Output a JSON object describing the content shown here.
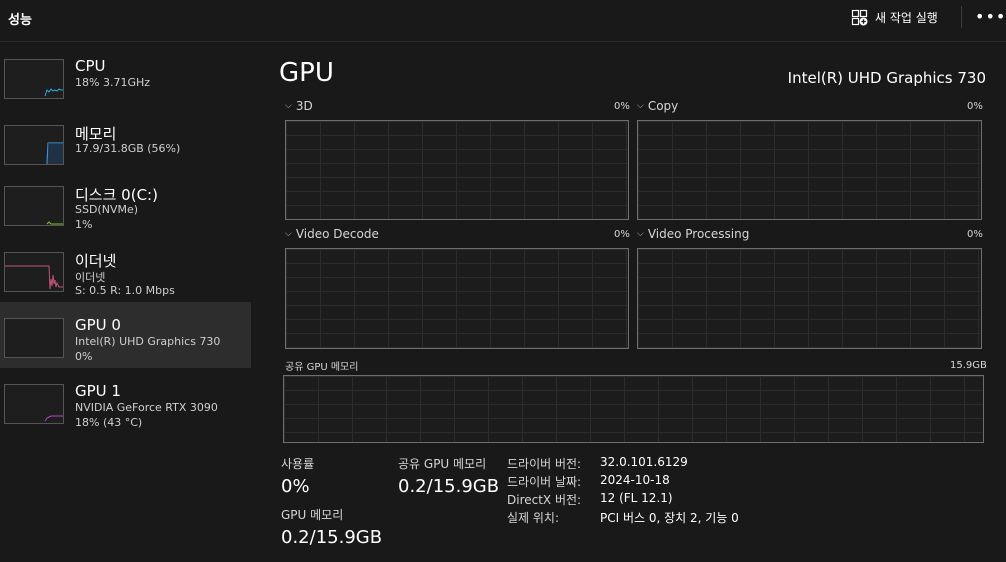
{
  "header": {
    "title": "성능",
    "run_task": "새 작업 실행",
    "more": "•••"
  },
  "sidebar": {
    "items": [
      {
        "name": "CPU",
        "line2": "18% 3.71GHz",
        "line3": ""
      },
      {
        "name": "메모리",
        "line2": "17.9/31.8GB (56%)",
        "line3": ""
      },
      {
        "name": "디스크 0(C:)",
        "line2": "SSD(NVMe)",
        "line3": "1%"
      },
      {
        "name": "이더넷",
        "line2": "이더넷",
        "line3": "S: 0.5  R: 1.0 Mbps"
      },
      {
        "name": "GPU 0",
        "line2": "Intel(R) UHD Graphics 730",
        "line3": "0%"
      },
      {
        "name": "GPU 1",
        "line2": "NVIDIA GeForce RTX 3090",
        "line3": "18% (43 °C)"
      }
    ],
    "selected_index": 4
  },
  "main": {
    "title": "GPU",
    "device": "Intel(R) UHD Graphics 730",
    "graphs": [
      {
        "label": "3D",
        "value": "0%"
      },
      {
        "label": "Copy",
        "value": "0%"
      },
      {
        "label": "Video Decode",
        "value": "0%"
      },
      {
        "label": "Video Processing",
        "value": "0%"
      }
    ],
    "shared_memory": {
      "label": "공유 GPU 메모리",
      "max": "15.9GB"
    },
    "stats": {
      "usage_label": "사용률",
      "usage_value": "0%",
      "gpu_mem_label": "GPU 메모리",
      "gpu_mem_value": "0.2/15.9GB",
      "shared_label": "공유 GPU 메모리",
      "shared_value": "0.2/15.9GB"
    },
    "info": [
      {
        "key": "드라이버 버전:",
        "value": "32.0.101.6129"
      },
      {
        "key": "드라이버 날짜:",
        "value": "2024-10-18"
      },
      {
        "key": "DirectX 버전:",
        "value": "12 (FL 12.1)"
      },
      {
        "key": "실제 위치:",
        "value": "PCI 버스 0, 장치 2, 기능 0"
      }
    ]
  },
  "colors": {
    "cpu": "#2fa8d8",
    "memory": "#3c8fd6",
    "disk": "#7fbf3a",
    "ethernet": "#c2527a",
    "gpu1": "#b048c8"
  }
}
